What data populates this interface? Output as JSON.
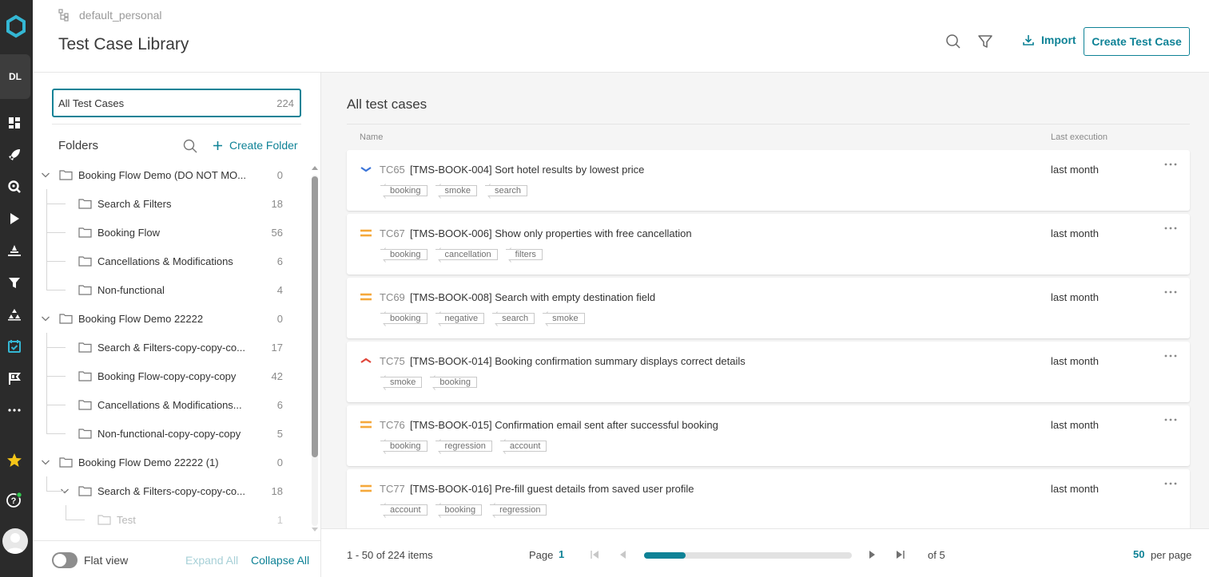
{
  "rail": {
    "project_initials": "DL",
    "icons": [
      "dashboard-icon",
      "launches-icon",
      "search-icon",
      "play-icon",
      "test-plan-icon",
      "filter-icon",
      "hierarchy-icon",
      "test-cases-icon",
      "milestones-icon",
      "more-icon",
      "favorites-icon",
      "help-icon"
    ],
    "accent_star": "#f5c518",
    "accent_logo": "#34b7d4",
    "status_dot": "#31c84e"
  },
  "header": {
    "breadcrumb": "default_personal",
    "title": "Test Case Library",
    "import_label": "Import",
    "create_label": "Create Test Case"
  },
  "folders": {
    "all_label": "All Test Cases",
    "all_count": "224",
    "heading": "Folders",
    "create_folder_label": "Create Folder",
    "items": [
      {
        "label": "Booking Flow Demo (DO NOT MO...",
        "count": "0",
        "level": 0,
        "expanded": true
      },
      {
        "label": "Search & Filters",
        "count": "18",
        "level": 1
      },
      {
        "label": "Booking Flow",
        "count": "56",
        "level": 1
      },
      {
        "label": "Cancellations & Modifications",
        "count": "6",
        "level": 1
      },
      {
        "label": "Non-functional",
        "count": "4",
        "level": 1
      },
      {
        "label": "Booking Flow Demo 22222",
        "count": "0",
        "level": 0,
        "expanded": true
      },
      {
        "label": "Search & Filters-copy-copy-co...",
        "count": "17",
        "level": 1
      },
      {
        "label": "Booking Flow-copy-copy-copy",
        "count": "42",
        "level": 1
      },
      {
        "label": "Cancellations & Modifications...",
        "count": "6",
        "level": 1
      },
      {
        "label": "Non-functional-copy-copy-copy",
        "count": "5",
        "level": 1
      },
      {
        "label": "Booking Flow Demo 22222 (1)",
        "count": "0",
        "level": 0,
        "expanded": true
      },
      {
        "label": "Search & Filters-copy-copy-co...",
        "count": "18",
        "level": 1,
        "expanded": true
      },
      {
        "label": "Test",
        "count": "1",
        "level": 2,
        "dim": true
      }
    ],
    "flat_view_label": "Flat view",
    "expand_all_label": "Expand All",
    "collapse_all_label": "Collapse All"
  },
  "main": {
    "title": "All test cases",
    "col_name": "Name",
    "col_exec": "Last execution",
    "cases": [
      {
        "id": "TC65",
        "name": "[TMS-BOOK-004] Sort hotel results by lowest price",
        "exec": "last month",
        "priority": "low",
        "tags": [
          "booking",
          "smoke",
          "search"
        ]
      },
      {
        "id": "TC67",
        "name": "[TMS-BOOK-006] Show only properties with free cancellation",
        "exec": "last month",
        "priority": "medium",
        "tags": [
          "booking",
          "cancellation",
          "filters"
        ]
      },
      {
        "id": "TC69",
        "name": "[TMS-BOOK-008] Search with empty destination field",
        "exec": "last month",
        "priority": "medium",
        "tags": [
          "booking",
          "negative",
          "search",
          "smoke"
        ]
      },
      {
        "id": "TC75",
        "name": "[TMS-BOOK-014] Booking confirmation summary displays correct details",
        "exec": "last month",
        "priority": "high",
        "tags": [
          "smoke",
          "booking"
        ]
      },
      {
        "id": "TC76",
        "name": "[TMS-BOOK-015] Confirmation email sent after successful booking",
        "exec": "last month",
        "priority": "medium",
        "tags": [
          "booking",
          "regression",
          "account"
        ]
      },
      {
        "id": "TC77",
        "name": "[TMS-BOOK-016] Pre-fill guest details from saved user profile",
        "exec": "last month",
        "priority": "medium",
        "tags": [
          "account",
          "booking",
          "regression"
        ]
      }
    ],
    "priority_colors": {
      "low": "#3b74d8",
      "medium": "#f5a83b",
      "high": "#e0463a"
    }
  },
  "pager": {
    "items_label": "1 - 50 of 224 items",
    "page_label": "Page",
    "page": "1",
    "of_label": "of 5",
    "progress": 0.2,
    "per_page": "50",
    "per_page_label": "per page"
  }
}
